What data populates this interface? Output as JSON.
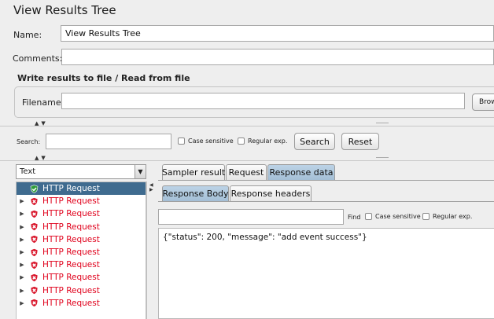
{
  "panel": {
    "title": "View Results Tree"
  },
  "name": {
    "label": "Name:",
    "value": "View Results Tree"
  },
  "comments": {
    "label": "Comments:",
    "value": ""
  },
  "file_section": {
    "title": "Write results to file / Read from file",
    "filename_label": "Filename",
    "filename_value": "",
    "browse_label": "Brow"
  },
  "search": {
    "label": "Search:",
    "value": "",
    "case_sensitive": "Case sensitive",
    "regular_exp": "Regular exp.",
    "search_button": "Search",
    "reset_button": "Reset"
  },
  "renderer": {
    "selected": "Text"
  },
  "tree": {
    "items": [
      {
        "label": "HTTP Request",
        "status": "success",
        "selected": true
      },
      {
        "label": "HTTP Request",
        "status": "error"
      },
      {
        "label": "HTTP Request",
        "status": "error"
      },
      {
        "label": "HTTP Request",
        "status": "error"
      },
      {
        "label": "HTTP Request",
        "status": "error"
      },
      {
        "label": "HTTP Request",
        "status": "error"
      },
      {
        "label": "HTTP Request",
        "status": "error"
      },
      {
        "label": "HTTP Request",
        "status": "error"
      },
      {
        "label": "HTTP Request",
        "status": "error"
      },
      {
        "label": "HTTP Request",
        "status": "error"
      }
    ]
  },
  "tabs": {
    "sampler_result": "Sampler result",
    "request": "Request",
    "response_data": "Response data",
    "active": "response_data"
  },
  "subtabs": {
    "response_body": "Response Body",
    "response_headers": "Response headers",
    "active": "response_body"
  },
  "find": {
    "value": "",
    "label": "Find",
    "case_sensitive": "Case sensitive",
    "regular_exp": "Regular exp."
  },
  "response": {
    "body": "{\"status\": 200, \"message\": \"add event success\"}"
  },
  "colors": {
    "selected_row": "#3f6b8f",
    "error_text": "#e0001b",
    "success_icon": "#2e9b3a",
    "error_icon": "#d9182d",
    "active_tab": "#a9c3d9"
  }
}
